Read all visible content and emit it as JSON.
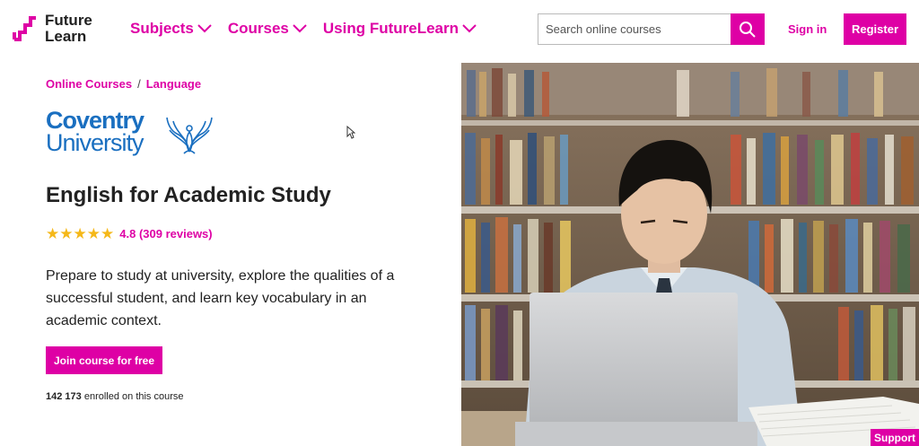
{
  "header": {
    "logo_line1": "Future",
    "logo_line2": "Learn",
    "nav": [
      {
        "label": "Subjects"
      },
      {
        "label": "Courses"
      },
      {
        "label": "Using FutureLearn"
      }
    ],
    "search_placeholder": "Search online courses",
    "signin_label": "Sign in",
    "register_label": "Register"
  },
  "breadcrumb": {
    "items": [
      "Online Courses",
      "Language"
    ],
    "separator": "/"
  },
  "university": {
    "line1": "Coventry",
    "line2": "University"
  },
  "course": {
    "title": "English for Academic Study",
    "rating_value": "4.8",
    "rating_stars": 4.8,
    "reviews": "(309 reviews)",
    "description": "Prepare to study at university, explore the qualities of a successful student, and learn key vocabulary in an academic context.",
    "join_label": "Join course for free",
    "enrolled_count": "142 173",
    "enrolled_text": "enrolled on this course"
  },
  "support_label": "Support",
  "colors": {
    "brand": "#de00a5",
    "university_blue": "#1a6fc0",
    "star": "#f5b819"
  },
  "icons": [
    "logo-mark-icon",
    "chevron-down-icon",
    "search-icon",
    "star-icon",
    "phoenix-icon",
    "mouse-cursor-icon"
  ]
}
